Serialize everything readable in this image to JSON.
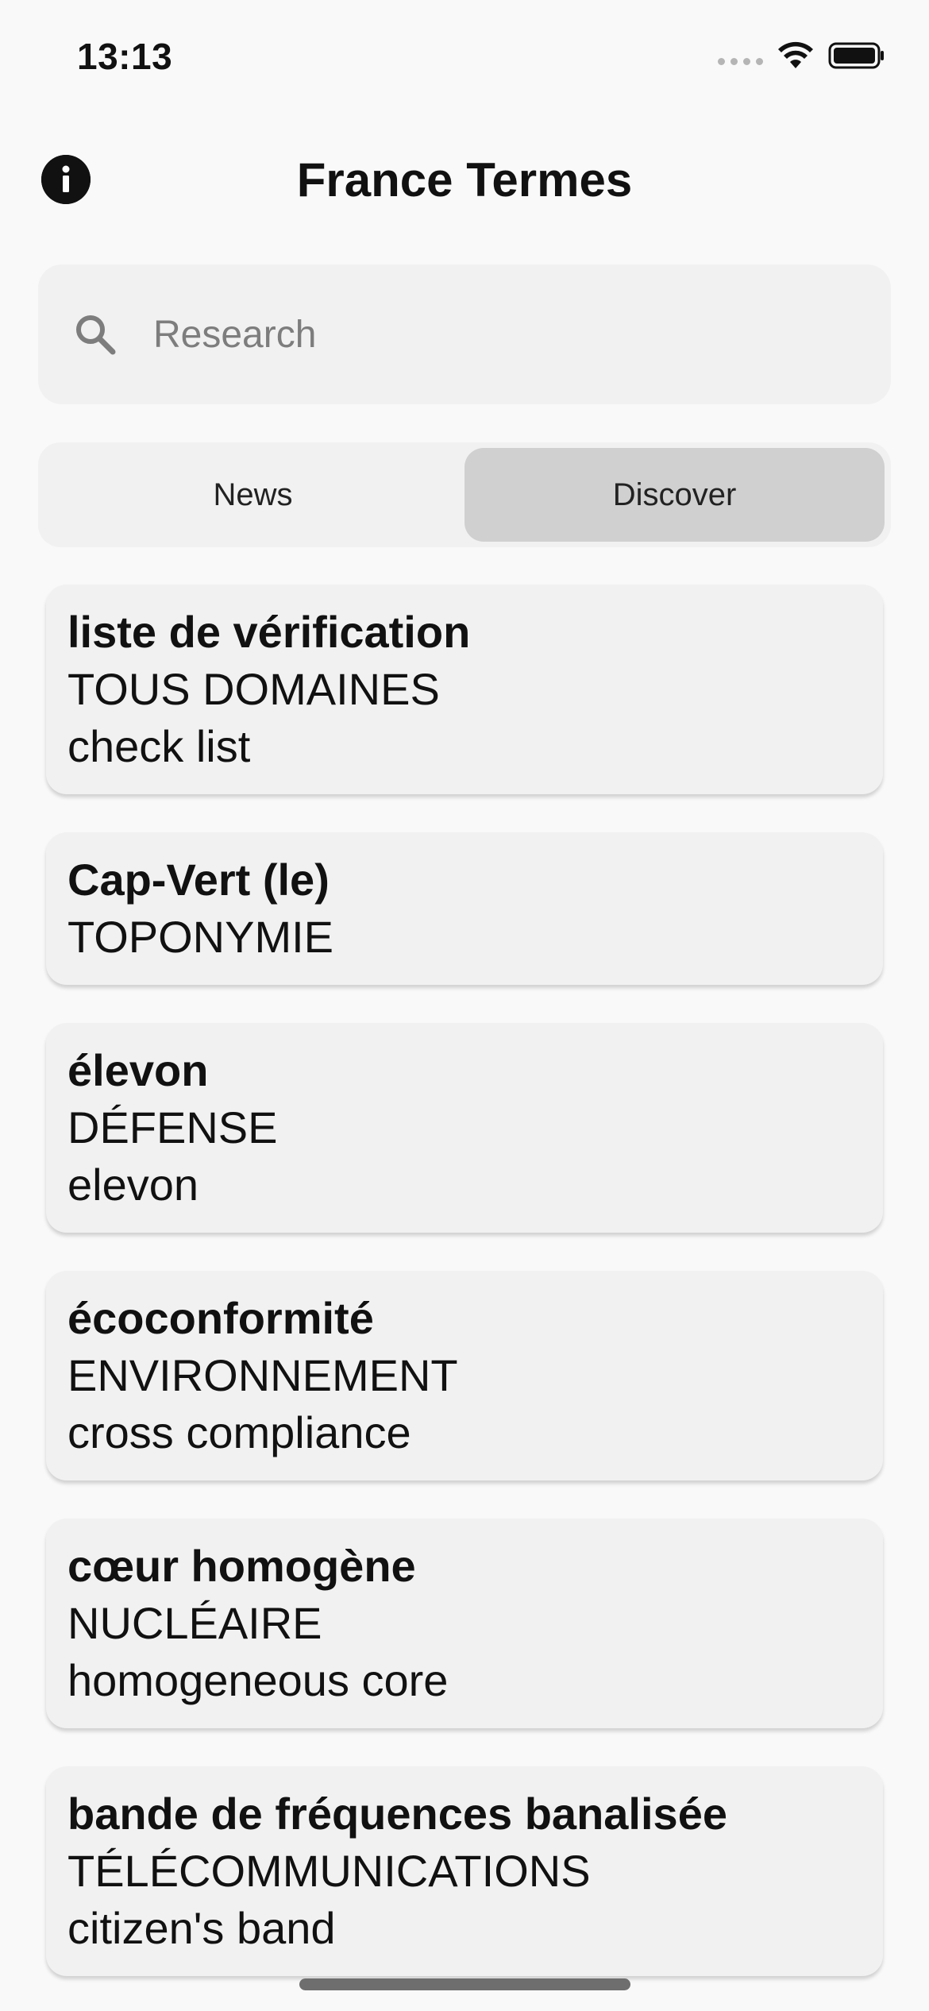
{
  "status_bar": {
    "time": "13:13",
    "icons": [
      "cellular-signal-icon",
      "wifi-icon",
      "battery-icon"
    ]
  },
  "header": {
    "title": "France Termes",
    "info_icon": "info-icon"
  },
  "search": {
    "placeholder": "Research",
    "value": "",
    "icon": "search-icon"
  },
  "tabs": [
    {
      "label": "News",
      "selected": false
    },
    {
      "label": "Discover",
      "selected": true
    }
  ],
  "terms": [
    {
      "name": "liste de vérification",
      "domain": "TOUS DOMAINES",
      "translation": "check list"
    },
    {
      "name": "Cap-Vert (le)",
      "domain": "TOPONYMIE",
      "translation": ""
    },
    {
      "name": "élevon",
      "domain": "DÉFENSE",
      "translation": "elevon"
    },
    {
      "name": "écoconformité",
      "domain": "ENVIRONNEMENT",
      "translation": "cross compliance"
    },
    {
      "name": "cœur homogène",
      "domain": "NUCLÉAIRE",
      "translation": "homogeneous core"
    },
    {
      "name": "bande de fréquences banalisée",
      "domain": "TÉLÉCOMMUNICATIONS",
      "translation": "citizen's band"
    }
  ],
  "colors": {
    "background": "#f9f9f9",
    "card": "#f1f1f1",
    "selected_tab": "#d0d0d0",
    "text": "#111111",
    "placeholder": "#7d7d7d"
  }
}
